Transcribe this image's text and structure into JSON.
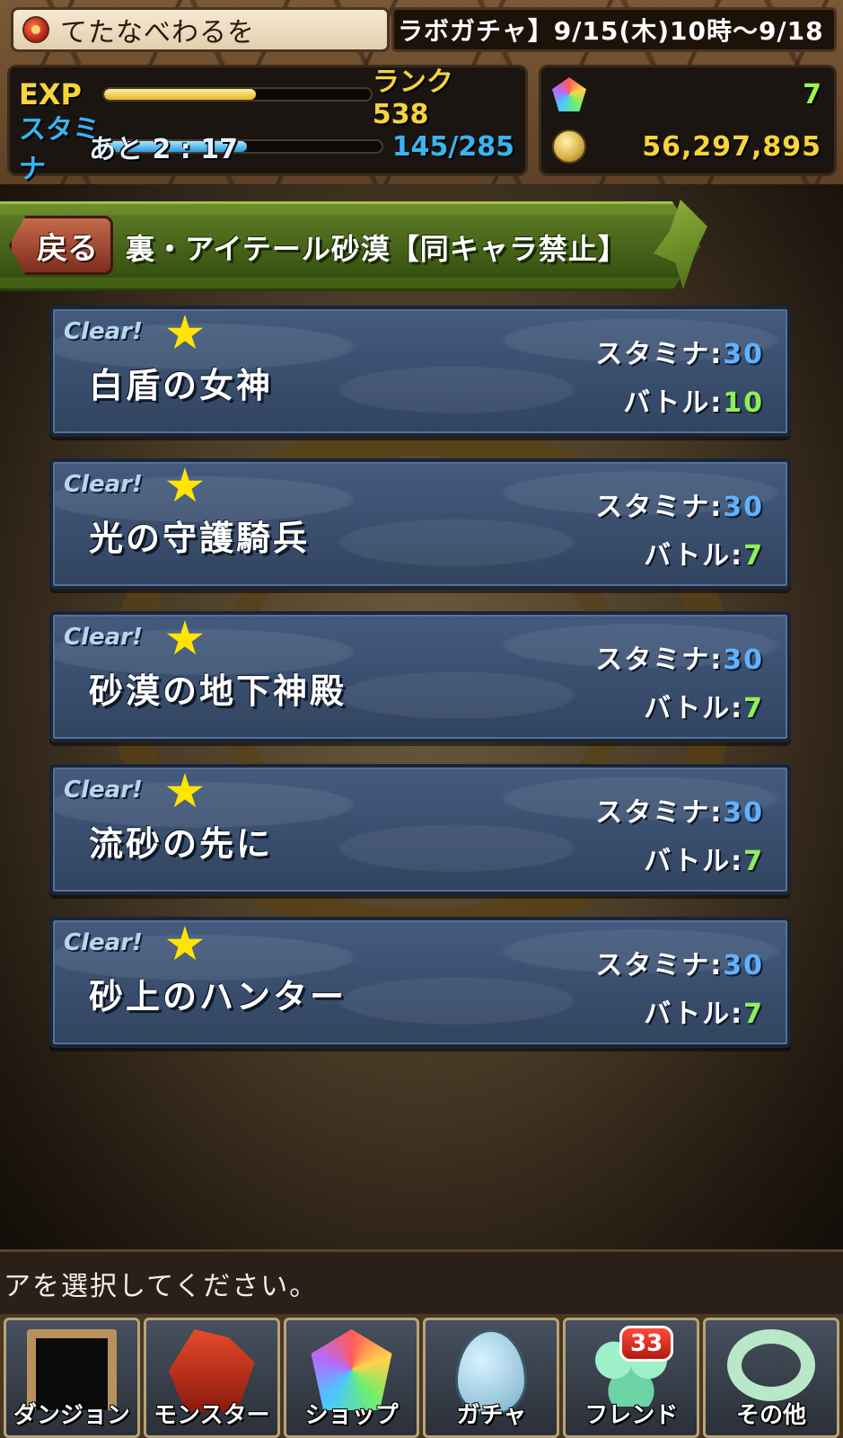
{
  "header": {
    "player_name": "てたなべわるを",
    "news_ticker": "ラボガチャ】9/15(木)10時～9/18",
    "exp": {
      "label": "EXP",
      "rank_text": "ランク 538",
      "progress": 0.57
    },
    "stamina": {
      "label": "スタミナ",
      "timer_text": "あと 2 : 17",
      "value_text": "145/285",
      "progress": 0.51
    },
    "magic_stones": {
      "icon": "rainbow-stone-icon",
      "value": "7"
    },
    "coins": {
      "icon": "coin-icon",
      "value": "56,297,895"
    }
  },
  "dungeon": {
    "back_label": "戻る",
    "title": "裏・アイテール砂漠【同キャラ禁止】"
  },
  "floors": [
    {
      "clear": "Clear!",
      "name": "白盾の女神",
      "stamina_label": "スタミナ:",
      "stamina": "30",
      "battle_label": "バトル:",
      "battles": "10"
    },
    {
      "clear": "Clear!",
      "name": "光の守護騎兵",
      "stamina_label": "スタミナ:",
      "stamina": "30",
      "battle_label": "バトル:",
      "battles": "7"
    },
    {
      "clear": "Clear!",
      "name": "砂漠の地下神殿",
      "stamina_label": "スタミナ:",
      "stamina": "30",
      "battle_label": "バトル:",
      "battles": "7"
    },
    {
      "clear": "Clear!",
      "name": "流砂の先に",
      "stamina_label": "スタミナ:",
      "stamina": "30",
      "battle_label": "バトル:",
      "battles": "7"
    },
    {
      "clear": "Clear!",
      "name": "砂上のハンター",
      "stamina_label": "スタミナ:",
      "stamina": "30",
      "battle_label": "バトル:",
      "battles": "7"
    }
  ],
  "message": "アを選択してください。",
  "nav": [
    {
      "label": "ダンジョン",
      "icon": "dungeon-gate-icon"
    },
    {
      "label": "モンスター",
      "icon": "monster-icon"
    },
    {
      "label": "ショップ",
      "icon": "gem-icon"
    },
    {
      "label": "ガチャ",
      "icon": "egg-icon"
    },
    {
      "label": "フレンド",
      "icon": "friend-icon",
      "badge": "33"
    },
    {
      "label": "その他",
      "icon": "other-icon"
    }
  ],
  "colors": {
    "accent_green": "#5a7824",
    "floor_blue": "#3b5070",
    "stamina_blue": "#39b4f0",
    "exp_yellow": "#f6d43a"
  }
}
